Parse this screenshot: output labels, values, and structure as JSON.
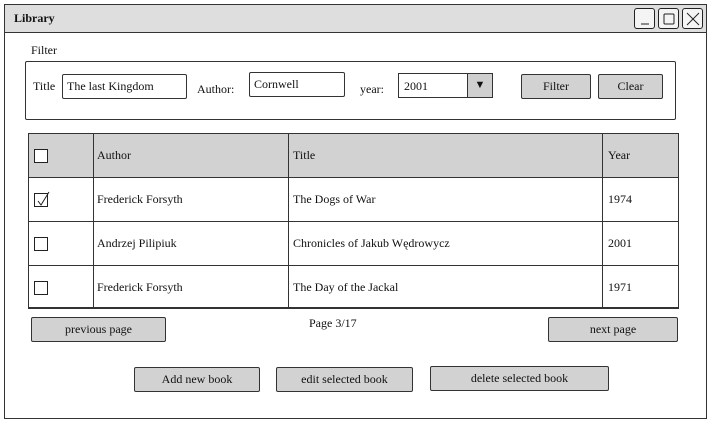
{
  "window": {
    "title": "Library"
  },
  "filter": {
    "section_label": "Filter",
    "title_label": "Title",
    "title_value": "The last Kingdom",
    "author_label": "Author:",
    "author_value": "Cornwell",
    "year_label": "year:",
    "year_value": "2001",
    "filter_button": "Filter",
    "clear_button": "Clear"
  },
  "table": {
    "headers": {
      "author": "Author",
      "title": "Title",
      "year": "Year"
    },
    "rows": [
      {
        "author": "Frederick Forsyth",
        "title": "The Dogs of War",
        "year": "1974",
        "checked": true
      },
      {
        "author": "Andrzej Pilipiuk",
        "title": "Chronicles of Jakub Wędrowycz",
        "year": "2001",
        "checked": false
      },
      {
        "author": "Frederick Forsyth",
        "title": "The Day of the Jackal",
        "year": "1971",
        "checked": false
      }
    ]
  },
  "pagination": {
    "previous": "previous page",
    "info": "Page 3/17",
    "next": "next page"
  },
  "actions": {
    "add": "Add new book",
    "edit": "edit selected book",
    "delete": "delete selected book"
  },
  "icons": {
    "minimize": "minimize-icon",
    "maximize": "maximize-icon",
    "close": "close-icon",
    "dropdown": "dropdown-arrow-icon",
    "check": "checkmark-icon"
  }
}
